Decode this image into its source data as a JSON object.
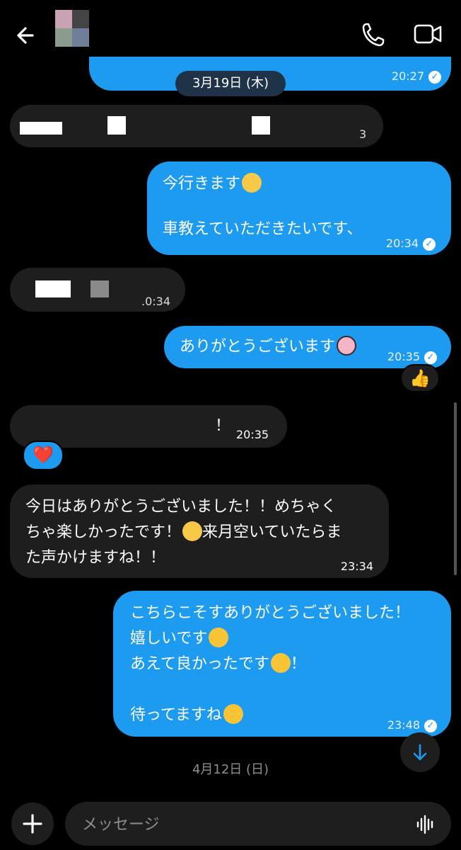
{
  "header": {
    "back_icon": "arrow-left-icon",
    "call_icon": "phone-icon",
    "video_icon": "video-camera-icon"
  },
  "colors": {
    "outgoing_bubble": "#1d9bf0",
    "incoming_bubble": "#1e1e1e",
    "background": "#000000"
  },
  "dates": {
    "first": "3月19日 (木)",
    "second": "4月12日 (日)"
  },
  "messages": [
    {
      "id": "m0",
      "direction": "out",
      "time": "20:27",
      "read": true
    },
    {
      "id": "m1",
      "direction": "in",
      "text_visible": "3",
      "redacted": true
    },
    {
      "id": "m2",
      "direction": "out",
      "lines": [
        "今行きます",
        "",
        "車教えていただきたいです、"
      ],
      "time": "20:34",
      "read": true
    },
    {
      "id": "m3",
      "direction": "in",
      "time": ".0:34",
      "redacted": true
    },
    {
      "id": "m4",
      "direction": "out",
      "text": "ありがとうございます",
      "time": "20:35",
      "read": true,
      "reaction": "👍"
    },
    {
      "id": "m5",
      "direction": "in",
      "text": "！",
      "time": "20:35",
      "redacted": true,
      "reaction": "❤️"
    },
    {
      "id": "m6",
      "direction": "in",
      "lines": [
        "今日はありがとうございました！！めちゃく",
        "ちゃ楽しかったです！",
        "来月空いていたらま",
        "た声かけますね！！"
      ],
      "time": "23:34"
    },
    {
      "id": "m7",
      "direction": "out",
      "lines": [
        "こちらこそすありがとうございました！",
        "嬉しいです",
        "あえて良かったです",
        "！",
        "",
        "待ってますね"
      ],
      "time": "23:48",
      "read": true
    }
  ],
  "composer": {
    "placeholder": "メッセージ",
    "plus_icon": "plus-icon",
    "mic_icon": "audio-wave-icon"
  },
  "scroll_button_icon": "arrow-down-icon"
}
